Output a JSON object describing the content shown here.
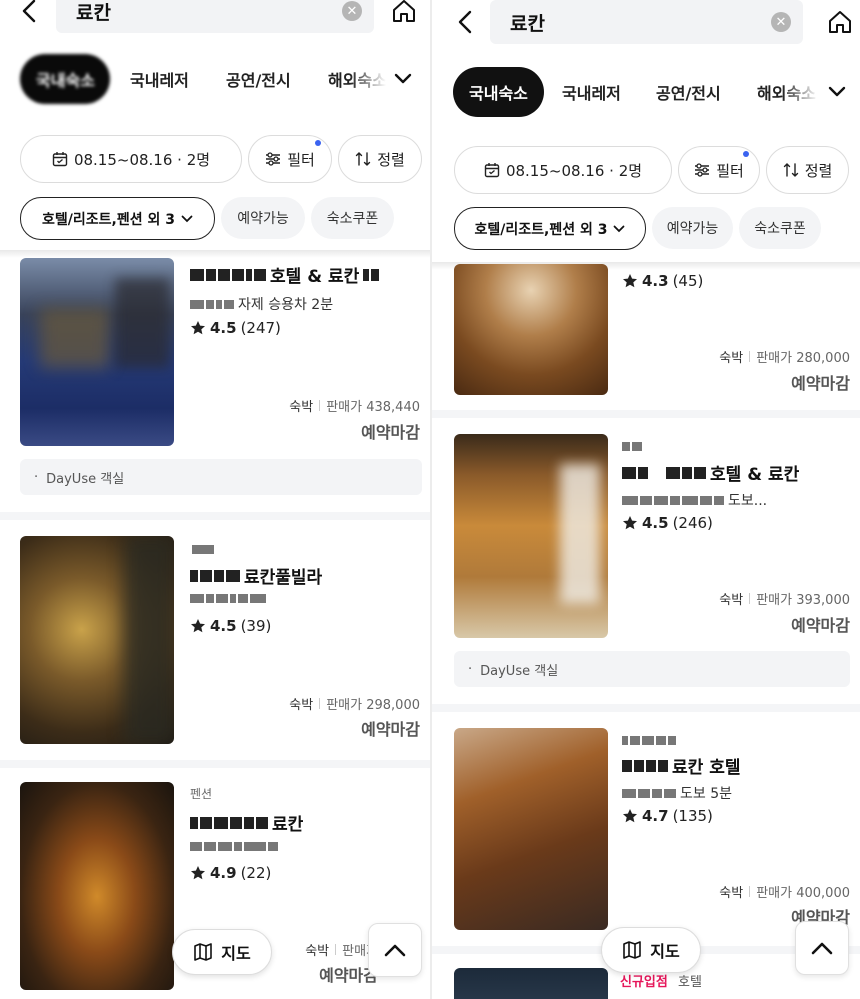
{
  "search": {
    "query": "료칸"
  },
  "left": {
    "tabs": {
      "active_label": "국내숙소",
      "items": [
        "국내레저",
        "공연/전시",
        "해외숙소"
      ]
    },
    "filters": {
      "date_guests": "08.15~08.16 · 2명",
      "filter_label": "필터",
      "sort_label": "정렬"
    },
    "chips": {
      "category": "호텔/리조트,펜션 외 3",
      "available": "예약가능",
      "coupon": "숙소쿠폰"
    },
    "listings": [
      {
        "name_suffix": "호텔 & 료칸",
        "location_suffix": "자제 승용차 2분",
        "rating": "4.5",
        "reviews": "(247)",
        "stay": "숙박",
        "price_label": "판매가 438,440",
        "status": "예약마감",
        "dayuse": "DayUse 객실"
      },
      {
        "name_suffix": "료칸풀빌라",
        "rating": "4.5",
        "reviews": "(39)",
        "stay": "숙박",
        "price_label": "판매가 298,000",
        "status": "예약마감"
      },
      {
        "category": "펜션",
        "name_suffix": "료칸",
        "rating": "4.9",
        "reviews": "(22)",
        "stay": "숙박",
        "price_label": "판매가 ",
        "status": "예약마감"
      }
    ]
  },
  "right": {
    "tabs": {
      "active_label": "국내숙소",
      "items": [
        "국내레저",
        "공연/전시",
        "해외숙소"
      ]
    },
    "filters": {
      "date_guests": "08.15~08.16 · 2명",
      "filter_label": "필터",
      "sort_label": "정렬"
    },
    "chips": {
      "category": "호텔/리조트,펜션 외 3",
      "available": "예약가능",
      "coupon": "숙소쿠폰"
    },
    "listings": [
      {
        "rating": "4.3",
        "reviews": "(45)",
        "stay": "숙박",
        "price_label": "판매가 280,000",
        "status": "예약마감"
      },
      {
        "name_suffix": "호텔 & 료칸",
        "location_suffix": "도보...",
        "rating": "4.5",
        "reviews": "(246)",
        "stay": "숙박",
        "price_label": "판매가 393,000",
        "status": "예약마감",
        "dayuse": "DayUse 객실"
      },
      {
        "name_suffix": "료칸 호텔",
        "location_suffix": "도보 5분",
        "rating": "4.7",
        "reviews": "(135)",
        "stay": "숙박",
        "price_label": "판매가 400,000",
        "status": "예약마감"
      },
      {
        "new_tag": "신규입점",
        "category": "호텔"
      }
    ]
  },
  "floating": {
    "map_label": "지도"
  },
  "colors": {
    "accent": "#111111",
    "new_tag": "#e6165a",
    "notice_dot": "#3a63f0"
  },
  "icons": [
    "back-icon",
    "clear-icon",
    "home-icon",
    "chevron-down-icon",
    "calendar-icon",
    "filter-icon",
    "sort-icon",
    "star-icon",
    "map-icon",
    "arrow-up-icon"
  ]
}
